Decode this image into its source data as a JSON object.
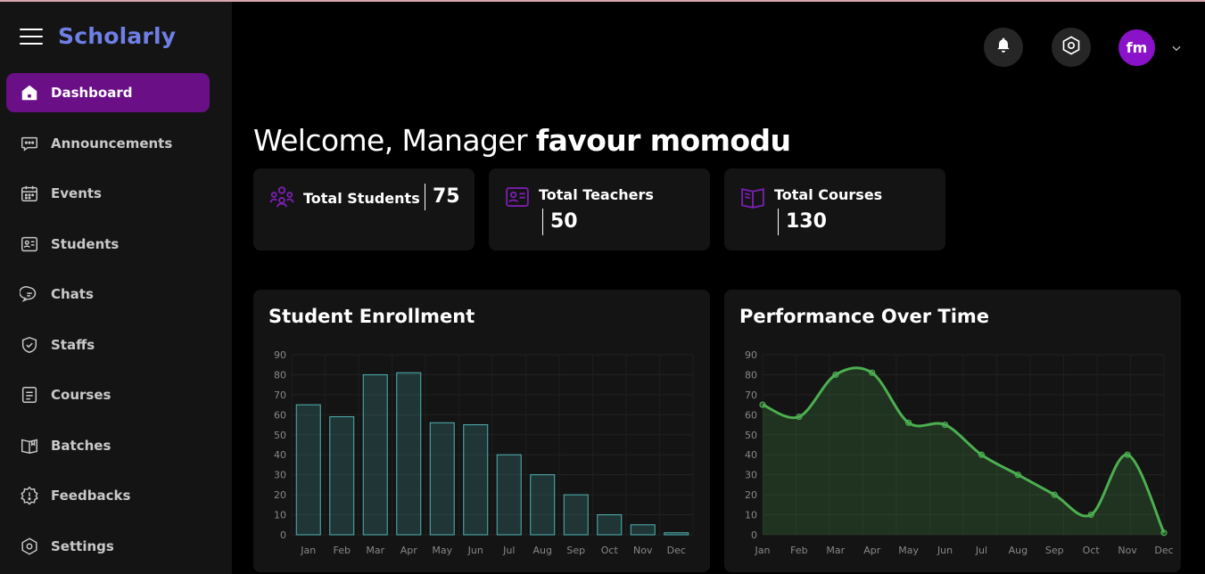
{
  "app": {
    "brand": "Scholarly"
  },
  "sidebar": {
    "items": [
      {
        "label": "Dashboard",
        "icon": "home-icon",
        "active": true
      },
      {
        "label": "Announcements",
        "icon": "message-dots-icon"
      },
      {
        "label": "Events",
        "icon": "calendar-icon"
      },
      {
        "label": "Students",
        "icon": "id-card-icon"
      },
      {
        "label": "Chats",
        "icon": "chat-bubbles-icon"
      },
      {
        "label": "Staffs",
        "icon": "shield-check-icon"
      },
      {
        "label": "Courses",
        "icon": "document-icon"
      },
      {
        "label": "Batches",
        "icon": "book-open-icon"
      },
      {
        "label": "Feedbacks",
        "icon": "alert-badge-icon"
      },
      {
        "label": "Settings",
        "icon": "hex-settings-icon"
      }
    ]
  },
  "header": {
    "notifications_icon": "bell-icon",
    "settings_icon": "hex-settings-icon",
    "avatar_initials": "fm",
    "avatar_color": "#8a12c8"
  },
  "welcome": {
    "prefix": "Welcome, Manager ",
    "name": "favour momodu"
  },
  "stats": [
    {
      "title": "Total Students",
      "value": "75",
      "icon": "users-group-icon"
    },
    {
      "title": "Total Teachers",
      "value": "50",
      "icon": "teacher-id-icon"
    },
    {
      "title": "Total Courses",
      "value": "130",
      "icon": "book-icon"
    }
  ],
  "colors": {
    "accent": "#6a0f86",
    "icon_purple": "#7a1fb0",
    "bar_stroke": "#4fb3b3",
    "line": "#4caf50"
  },
  "chart_data": [
    {
      "type": "bar",
      "title": "Student Enrollment",
      "categories": [
        "Jan",
        "Feb",
        "Mar",
        "Apr",
        "May",
        "Jun",
        "Jul",
        "Aug",
        "Sep",
        "Oct",
        "Nov",
        "Dec"
      ],
      "values": [
        65,
        59,
        80,
        81,
        56,
        55,
        40,
        30,
        20,
        10,
        5,
        1
      ],
      "ylim": [
        0,
        90
      ],
      "yticks": [
        0,
        10,
        20,
        30,
        40,
        50,
        60,
        70,
        80,
        90
      ],
      "grid": true
    },
    {
      "type": "area",
      "title": "Performance Over Time",
      "categories": [
        "Jan",
        "Feb",
        "Mar",
        "Apr",
        "May",
        "Jun",
        "Jul",
        "Aug",
        "Sep",
        "Oct",
        "Nov",
        "Dec"
      ],
      "values": [
        65,
        59,
        80,
        81,
        56,
        55,
        40,
        30,
        20,
        10,
        40,
        1
      ],
      "ylim": [
        0,
        90
      ],
      "yticks": [
        0,
        10,
        20,
        30,
        40,
        50,
        60,
        70,
        80,
        90
      ],
      "grid": true
    }
  ]
}
